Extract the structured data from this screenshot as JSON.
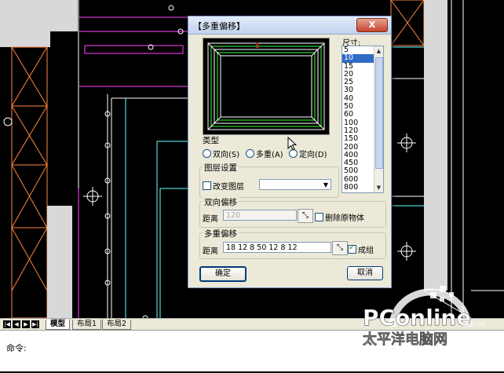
{
  "dialog": {
    "title": "【多重偏移】",
    "close_label": "X",
    "size_label": "尺寸:",
    "sizes": [
      "5",
      "10",
      "15",
      "20",
      "25",
      "30",
      "40",
      "50",
      "60",
      "100",
      "120",
      "150",
      "200",
      "400",
      "450",
      "500",
      "600",
      "800"
    ],
    "selected_size": "10",
    "type_group": {
      "label": "类型",
      "options": [
        "双向(S)",
        "多重(A)",
        "定向(D)"
      ]
    },
    "layer_group": {
      "label": "图层设置",
      "change_layer_label": "改变图层",
      "layer_value": ""
    },
    "bidirectional_group": {
      "label": "双向偏移",
      "distance_label": "距离",
      "distance_value": "120",
      "delete_source_label": "删除原物体"
    },
    "multi_group": {
      "label": "多重偏移",
      "distance_label": "距离",
      "distance_value": "18 12 8 50 12 8 12",
      "group_label": "成组"
    },
    "ok_label": "确定",
    "cancel_label": "取消"
  },
  "layout_tabs": [
    "模型",
    "布局1",
    "布局2"
  ],
  "command": {
    "label": "命令:"
  },
  "watermark": {
    "brand": "PConline",
    "domain": ".com.cn",
    "chinese": "太平洋电脑网"
  },
  "colors": {
    "canvas": "#000000",
    "dialog": "#ece9d8",
    "selected": "#316ac5",
    "accent_red": "#c6452d"
  }
}
